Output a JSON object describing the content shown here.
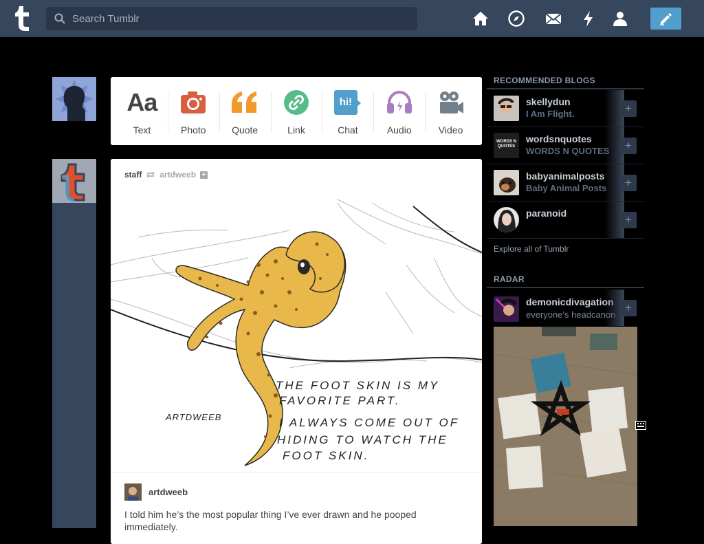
{
  "header": {
    "search_placeholder": "Search Tumblr",
    "nav": [
      "home-icon",
      "explore-icon",
      "inbox-icon",
      "activity-icon",
      "account-icon"
    ],
    "compose": "pencil-icon"
  },
  "post_types": [
    {
      "label": "Text",
      "glyph": "Aa",
      "color": "#444444"
    },
    {
      "label": "Photo",
      "color": "#d95e40"
    },
    {
      "label": "Quote",
      "glyph": "“",
      "color": "#f2992e"
    },
    {
      "label": "Link",
      "color": "#56bc8a"
    },
    {
      "label": "Chat",
      "glyph": "hi!",
      "color": "#529ecc"
    },
    {
      "label": "Audio",
      "color": "#a77dc2"
    },
    {
      "label": "Video",
      "color": "#748089"
    }
  ],
  "post": {
    "reblogger": "staff",
    "source": "artdweeb",
    "plus": "+",
    "comic": {
      "line1": "THE FOOT SKIN IS MY",
      "line2": "FAVORITE PART.",
      "line3": "I ALWAYS COME OUT OF",
      "line4": "HIDING TO WATCH THE",
      "line5": "FOOT SKIN.",
      "signature": "ARTDWEEB"
    },
    "author": "artdweeb",
    "caption": "I told him he’s the most popular thing I’ve ever drawn and he pooped immediately."
  },
  "sidebar": {
    "recommended_title": "RECOMMENDED BLOGS",
    "blogs": [
      {
        "name": "skellydun",
        "title": "I Am Flight."
      },
      {
        "name": "wordsnquotes",
        "title": "WORDS N QUOTES",
        "thumb_text": "WORDS N QUOTES"
      },
      {
        "name": "babyanimalposts",
        "title": "Baby Animal Posts"
      },
      {
        "name": "paranoid",
        "title": ""
      }
    ],
    "add": "+",
    "explore": "Explore all of Tumblr",
    "radar_title": "RADAR",
    "radar": {
      "name": "demonicdivagation",
      "title": "everyone's headcanon"
    }
  },
  "colors": {
    "header": "#36465d",
    "accent": "#529ecc",
    "background": "#000000"
  }
}
